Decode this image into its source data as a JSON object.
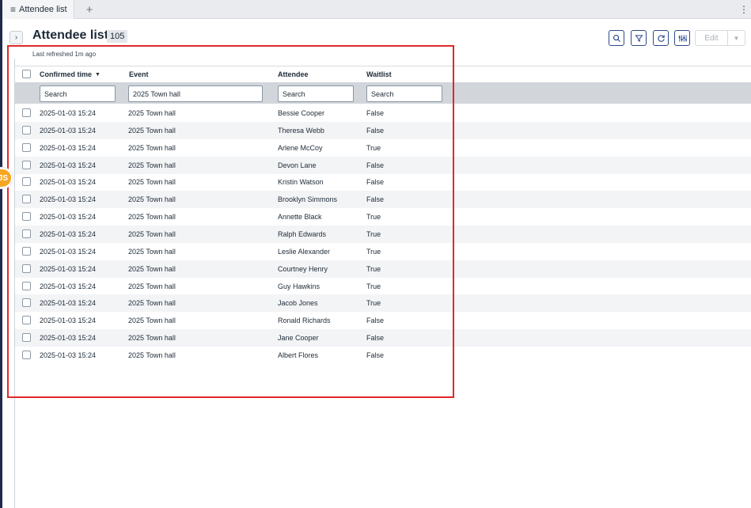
{
  "tab": {
    "menu_icon": "hamburger-icon",
    "title": "Attendee list",
    "add_icon": "plus-icon",
    "more_icon": "vertical-ellipsis-icon"
  },
  "header": {
    "title": "Attendee list",
    "count": "105",
    "refreshed": "Last refreshed 1m ago",
    "edit_label": "Edit",
    "toolbar_icons": [
      "search-icon",
      "filter-icon",
      "refresh-icon",
      "column-settings-icon"
    ]
  },
  "avatar": {
    "initials": "JS"
  },
  "columns": [
    {
      "label": "Confirmed time",
      "sorted": "descending"
    },
    {
      "label": "Event"
    },
    {
      "label": "Attendee"
    },
    {
      "label": "Waitlist"
    }
  ],
  "filters": {
    "confirmed_placeholder": "Search",
    "event_value": "2025 Town hall",
    "attendee_placeholder": "Search",
    "waitlist_placeholder": "Search"
  },
  "rows": [
    [
      "2025-01-03 15:24",
      "2025 Town hall",
      "Bessie Cooper",
      "False"
    ],
    [
      "2025-01-03 15:24",
      "2025 Town hall",
      "Theresa Webb",
      "False"
    ],
    [
      "2025-01-03 15:24",
      "2025 Town hall",
      "Arlene McCoy",
      "True"
    ],
    [
      "2025-01-03 15:24",
      "2025 Town hall",
      "Devon Lane",
      "False"
    ],
    [
      "2025-01-03 15:24",
      "2025 Town hall",
      "Kristin Watson",
      "False"
    ],
    [
      "2025-01-03 15:24",
      "2025 Town hall",
      "Brooklyn Simmons",
      "False"
    ],
    [
      "2025-01-03 15:24",
      "2025 Town hall",
      "Annette Black",
      "True"
    ],
    [
      "2025-01-03 15:24",
      "2025 Town hall",
      "Ralph Edwards",
      "True"
    ],
    [
      "2025-01-03 15:24",
      "2025 Town hall",
      "Leslie Alexander",
      "True"
    ],
    [
      "2025-01-03 15:24",
      "2025 Town hall",
      "Courtney Henry",
      "True"
    ],
    [
      "2025-01-03 15:24",
      "2025 Town hall",
      "Guy Hawkins",
      "True"
    ],
    [
      "2025-01-03 15:24",
      "2025 Town hall",
      "Jacob Jones",
      "True"
    ],
    [
      "2025-01-03 15:24",
      "2025 Town hall",
      "Ronald Richards",
      "False"
    ],
    [
      "2025-01-03 15:24",
      "2025 Town hall",
      "Jane Cooper",
      "False"
    ],
    [
      "2025-01-03 15:24",
      "2025 Town hall",
      "Albert Flores",
      "False"
    ]
  ]
}
